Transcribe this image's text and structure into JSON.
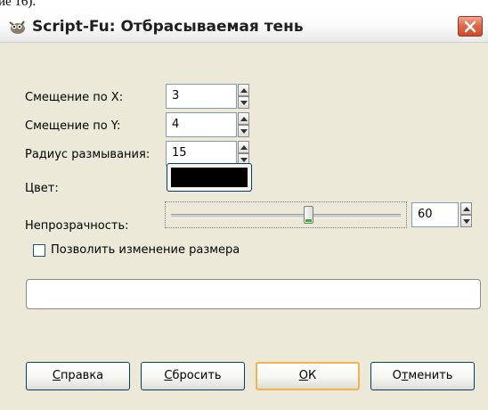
{
  "page_caption": "ие 16).",
  "window": {
    "title": "Script-Fu: Отбрасываемая тень",
    "app_icon": "gimp-wilber-icon",
    "close_icon": "close-icon"
  },
  "form": {
    "offset_x": {
      "label": "Смещение по X:",
      "value": "3"
    },
    "offset_y": {
      "label": "Смещение по Y:",
      "value": "4"
    },
    "blur_radius": {
      "label": "Радиус размывания:",
      "value": "15"
    },
    "color": {
      "label": "Цвет:",
      "swatch": "#000000"
    },
    "opacity": {
      "label": "Непрозрачность:",
      "value": "60",
      "level_percent": 60
    },
    "allow_resize": {
      "label": "Позволить изменение размера",
      "checked": false
    }
  },
  "progress": {
    "fraction": 0
  },
  "buttons": {
    "help": {
      "mnemonic": "С",
      "rest": "правка"
    },
    "reset": {
      "mnemonic": "С",
      "rest": "бросить"
    },
    "ok": {
      "mnemonic": "О",
      "rest": "К"
    },
    "cancel": {
      "pre": "О",
      "mnemonic": "т",
      "rest": "менить"
    }
  },
  "colors": {
    "dialog_bg": "#ece9d8",
    "close_red": "#e06a4c",
    "default_button_border": "#f2b24c",
    "slider_indicator": "#2fb52f"
  }
}
